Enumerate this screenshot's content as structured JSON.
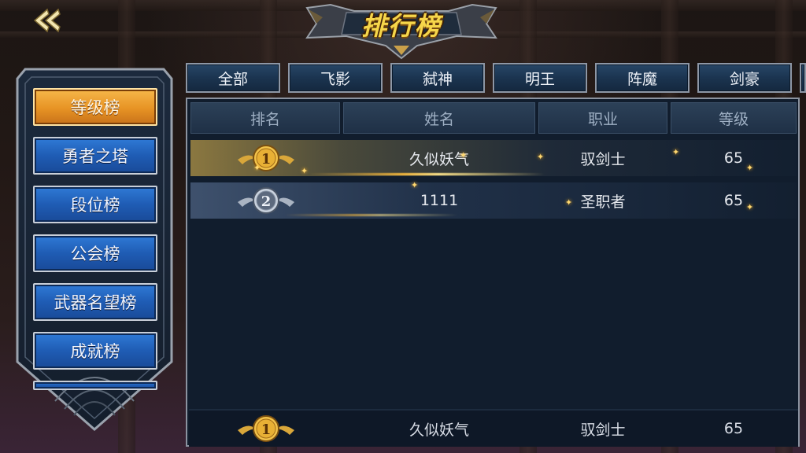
{
  "title": "排行榜",
  "sidebar": {
    "items": [
      {
        "label": "等级榜",
        "active": true
      },
      {
        "label": "勇者之塔",
        "active": false
      },
      {
        "label": "段位榜",
        "active": false
      },
      {
        "label": "公会榜",
        "active": false
      },
      {
        "label": "武器名望榜",
        "active": false
      },
      {
        "label": "成就榜",
        "active": false
      }
    ]
  },
  "tabs": [
    "全部",
    "飞影",
    "弑神",
    "明王",
    "阵魔",
    "剑豪"
  ],
  "table": {
    "columns": [
      "排名",
      "姓名",
      "职业",
      "等级"
    ],
    "rows": [
      {
        "rank": "1",
        "name": "久似妖气",
        "class": "驭剑士",
        "level": "65"
      },
      {
        "rank": "2",
        "name": "1111",
        "class": "圣职者",
        "level": "65"
      }
    ]
  },
  "self_row": {
    "rank": "1",
    "name": "久似妖气",
    "class": "驭剑士",
    "level": "65"
  },
  "colors": {
    "gold": "#f6d64a",
    "active_orange": "#e79324",
    "button_blue": "#1f5cb4",
    "panel_bg": "#111d2d"
  }
}
